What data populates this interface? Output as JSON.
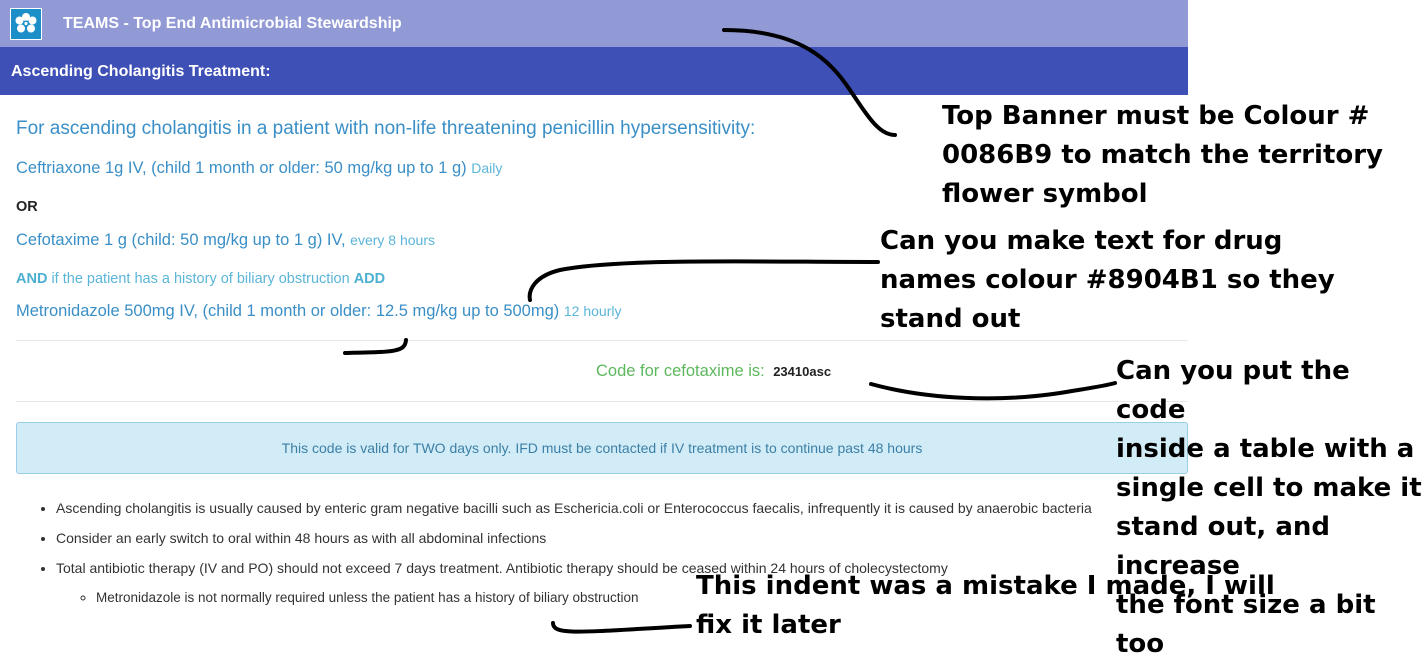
{
  "header": {
    "app_title": "TEAMS - Top End Antimicrobial Stewardship",
    "page_title": "Ascending Cholangitis Treatment:",
    "logo_icon": "flower-icon"
  },
  "treatment": {
    "intro": "For ascending cholangitis in a patient with non-life threatening penicillin hypersensitivity:",
    "drug1": "Ceftriaxone 1g IV, (child 1 month or older: 50 mg/kg up to 1 g)",
    "drug1_freq": "Daily",
    "or": "OR",
    "drug2": "Cefotaxime 1 g (child: 50 mg/kg up to 1 g) IV,",
    "drug2_freq": "every 8 hours",
    "and_prefix": "AND",
    "and_text": "if the patient has a history of biliary obstruction",
    "and_suffix": "ADD",
    "drug3": "Metronidazole 500mg IV, (child 1 month or older: 12.5 mg/kg up to 500mg)",
    "drug3_freq": "12 hourly"
  },
  "code": {
    "label": "Code for cefotaxime is:",
    "value": "23410asc"
  },
  "alert": {
    "text": "This code is valid for TWO days only. IFD must be contacted if IV treatment is to continue past 48 hours"
  },
  "notes": [
    "Ascending cholangitis is usually caused by enteric gram negative bacilli such as Eschericia.coli or Enterococcus faecalis, infrequently it is caused by anaerobic bacteria",
    "Consider an early switch to oral within 48 hours as with all abdominal infections",
    "Total antibiotic therapy (IV and PO) should not exceed 7 days treatment. Antibiotic therapy should be ceased within 24 hours of cholecystectomy"
  ],
  "sub_notes": [
    "Metronidazole is not normally required unless the patient has a history of biliary obstruction"
  ],
  "annotations": {
    "a1": [
      "Top Banner must be Colour #",
      "0086B9 to match the territory",
      "flower symbol"
    ],
    "a2": [
      "Can you make text for drug",
      "names colour #8904B1 so they",
      "stand out"
    ],
    "a3": [
      "Can you put the code",
      "inside a table with a",
      "single cell to make it",
      "stand out, and increase",
      "the font size a bit too"
    ],
    "a4": [
      "This indent was a mistake I made, I will",
      "fix it later"
    ]
  }
}
